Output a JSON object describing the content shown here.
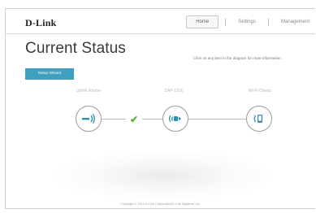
{
  "brand": {
    "logo_text": "D-Link"
  },
  "nav": {
    "items": [
      "Home",
      "Settings",
      "Management"
    ],
    "active": "Home"
  },
  "page": {
    "title": "Current Status",
    "info": "Click on any item in the diagram for more information.",
    "setup_wizard_label": "Setup Wizard"
  },
  "diagram": {
    "devices": [
      {
        "label": "Uplink Router",
        "icon": "router-uplink-icon"
      },
      {
        "label": "DAP-1320",
        "icon": "extender-icon"
      },
      {
        "label": "Wi-Fi Clients",
        "icon": "wifi-client-icon"
      }
    ],
    "link_status_icon": "check-icon"
  },
  "footer": {
    "copyright": "Copyright © 2013 D-Link Corporation/D-Link Systems, Inc."
  },
  "colors": {
    "accent": "#3f9fbd",
    "check": "#5bb53a",
    "circle_border": "#9c9c9c"
  }
}
